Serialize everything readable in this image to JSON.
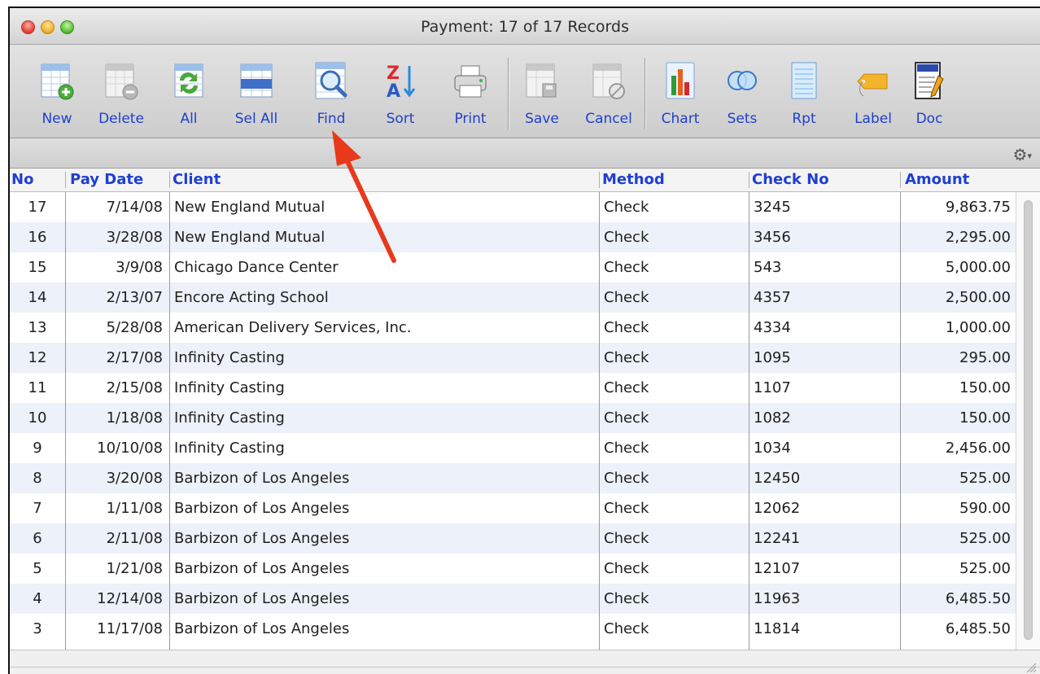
{
  "window": {
    "title": "Payment: 17 of 17 Records"
  },
  "toolbar": {
    "new": "New",
    "delete": "Delete",
    "all": "All",
    "sel_all": "Sel All",
    "find": "Find",
    "sort": "Sort",
    "print": "Print",
    "save": "Save",
    "cancel": "Cancel",
    "chart": "Chart",
    "sets": "Sets",
    "rpt": "Rpt",
    "label": "Label",
    "doc": "Doc"
  },
  "columns": {
    "no": "No",
    "pay_date": "Pay Date",
    "client": "Client",
    "method": "Method",
    "check_no": "Check No",
    "amount": "Amount"
  },
  "rows": [
    {
      "no": "17",
      "date": "7/14/08",
      "client": "New England Mutual",
      "method": "Check",
      "check": "3245",
      "amount": "9,863.75"
    },
    {
      "no": "16",
      "date": "3/28/08",
      "client": "New England Mutual",
      "method": "Check",
      "check": "3456",
      "amount": "2,295.00"
    },
    {
      "no": "15",
      "date": "3/9/08",
      "client": "Chicago Dance Center",
      "method": "Check",
      "check": "543",
      "amount": "5,000.00"
    },
    {
      "no": "14",
      "date": "2/13/07",
      "client": "Encore Acting School",
      "method": "Check",
      "check": "4357",
      "amount": "2,500.00"
    },
    {
      "no": "13",
      "date": "5/28/08",
      "client": "American Delivery Services, Inc.",
      "method": "Check",
      "check": "4334",
      "amount": "1,000.00"
    },
    {
      "no": "12",
      "date": "2/17/08",
      "client": "Infinity Casting",
      "method": "Check",
      "check": "1095",
      "amount": "295.00"
    },
    {
      "no": "11",
      "date": "2/15/08",
      "client": "Infinity Casting",
      "method": "Check",
      "check": "1107",
      "amount": "150.00"
    },
    {
      "no": "10",
      "date": "1/18/08",
      "client": "Infinity Casting",
      "method": "Check",
      "check": "1082",
      "amount": "150.00"
    },
    {
      "no": "9",
      "date": "10/10/08",
      "client": "Infinity Casting",
      "method": "Check",
      "check": "1034",
      "amount": "2,456.00"
    },
    {
      "no": "8",
      "date": "3/20/08",
      "client": "Barbizon of Los Angeles",
      "method": "Check",
      "check": "12450",
      "amount": "525.00"
    },
    {
      "no": "7",
      "date": "1/11/08",
      "client": "Barbizon of Los Angeles",
      "method": "Check",
      "check": "12062",
      "amount": "590.00"
    },
    {
      "no": "6",
      "date": "2/11/08",
      "client": "Barbizon of Los Angeles",
      "method": "Check",
      "check": "12241",
      "amount": "525.00"
    },
    {
      "no": "5",
      "date": "1/21/08",
      "client": "Barbizon of Los Angeles",
      "method": "Check",
      "check": "12107",
      "amount": "525.00"
    },
    {
      "no": "4",
      "date": "12/14/08",
      "client": "Barbizon of Los Angeles",
      "method": "Check",
      "check": "11963",
      "amount": "6,485.50"
    },
    {
      "no": "3",
      "date": "11/17/08",
      "client": "Barbizon of Los Angeles",
      "method": "Check",
      "check": "11814",
      "amount": "6,485.50"
    }
  ],
  "colors": {
    "accent": "#1f3fd0",
    "alt_row": "#edf1f9",
    "annotation_arrow": "#e8391d"
  }
}
